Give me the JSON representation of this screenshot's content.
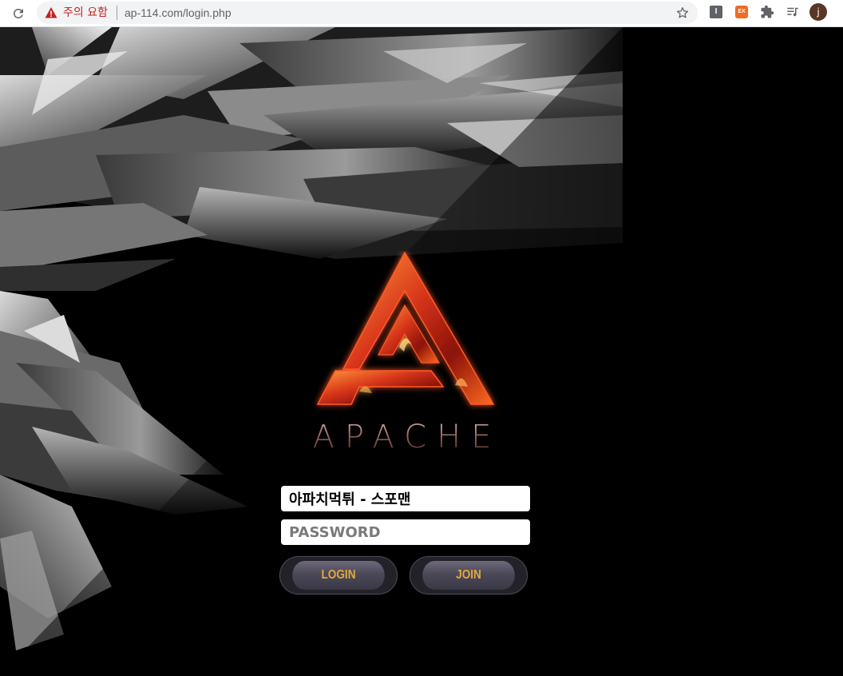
{
  "browser": {
    "security_warning": "주의 요함",
    "url": "ap-114.com/login.php",
    "avatar_letter": "j",
    "ext_i_label": "I",
    "ext_ex_label": "EX"
  },
  "login": {
    "brand": "APACHE",
    "id_value": "아파치먹튀 - 스포맨",
    "password_placeholder": "PASSWORD",
    "login_label": "LOGIN",
    "join_label": "JOIN"
  },
  "colors": {
    "warning_red": "#c5221f",
    "button_text": "#e3a93b",
    "logo_fire": "#d8361a"
  }
}
